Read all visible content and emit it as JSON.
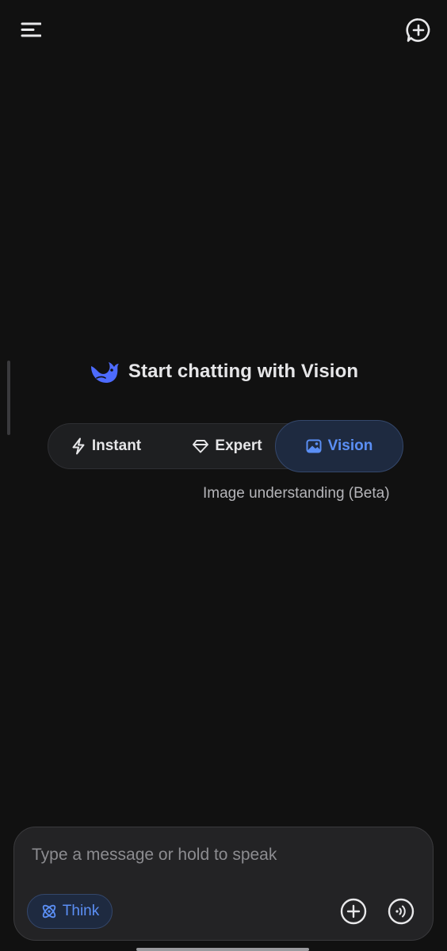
{
  "header": {
    "menu_icon": "menu-icon",
    "new_chat_icon": "new-chat-icon"
  },
  "hero": {
    "logo_icon": "whale-logo-icon",
    "title": "Start chatting with Vision"
  },
  "modes": {
    "items": [
      {
        "label": "Instant",
        "icon": "lightning-icon",
        "selected": false
      },
      {
        "label": "Expert",
        "icon": "diamond-icon",
        "selected": false
      },
      {
        "label": "Vision",
        "icon": "image-icon",
        "selected": true
      }
    ],
    "description": "Image understanding (Beta)"
  },
  "composer": {
    "placeholder": "Type a message or hold to speak",
    "value": "",
    "think_label": "Think",
    "think_icon": "atom-icon",
    "attach_icon": "plus-circle-icon",
    "voice_icon": "voice-wave-icon"
  },
  "colors": {
    "background": "#111111",
    "accent": "#5b8ff5",
    "accent_bg": "#1e2a40",
    "text": "#e6e6e8",
    "muted": "#b5b5b9"
  }
}
